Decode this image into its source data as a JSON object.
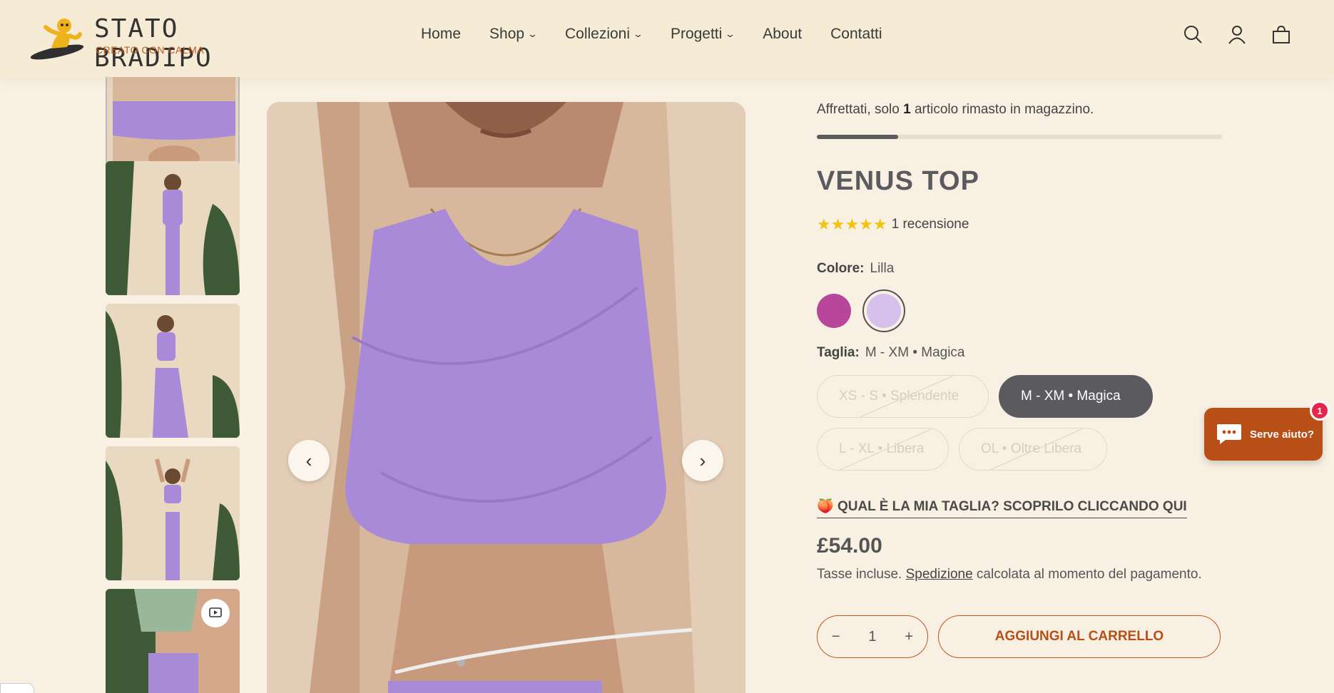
{
  "brand": {
    "name": "STATO BRADIPO",
    "tagline": "CREATO CON CALMA"
  },
  "nav": [
    {
      "label": "Home",
      "dropdown": false
    },
    {
      "label": "Shop",
      "dropdown": true
    },
    {
      "label": "Collezioni",
      "dropdown": true
    },
    {
      "label": "Progetti",
      "dropdown": true
    },
    {
      "label": "About",
      "dropdown": false
    },
    {
      "label": "Contatti",
      "dropdown": false
    }
  ],
  "header_icons": [
    "search-icon",
    "account-icon",
    "cart-bag-icon"
  ],
  "gallery": {
    "thumbnails": [
      "thumb-front-crop",
      "thumb-back-full",
      "thumb-back-side",
      "thumb-front-arms-up",
      "thumb-video"
    ],
    "video_icon": "play-video-icon",
    "prev_icon": "chevron-left-icon",
    "next_icon": "chevron-right-icon"
  },
  "product": {
    "stock_prefix": "Affrettati, solo ",
    "stock_count": "1",
    "stock_suffix": " articolo rimasto in magazzino.",
    "stock_level": 0.2,
    "title": "VENUS TOP",
    "stars": "★★★★★",
    "rating_value": 5,
    "reviews": "1 recensione",
    "color_label": "Colore:",
    "color_value": "Lilla",
    "colors": [
      {
        "name": "Magenta",
        "hex": "#b8469b",
        "selected": false
      },
      {
        "name": "Lilla",
        "hex": "#d6c0ec",
        "selected": true
      }
    ],
    "size_label": "Taglia:",
    "size_value": "M - XM • Magica",
    "sizes": [
      {
        "label": "XS - S • Splendente",
        "available": false,
        "selected": false
      },
      {
        "label": "M - XM • Magica",
        "available": true,
        "selected": true
      },
      {
        "label": "L - XL • Libera",
        "available": false,
        "selected": false
      },
      {
        "label": "OL • Oltre Libera",
        "available": false,
        "selected": false
      }
    ],
    "size_guide_icon": "peach-emoji",
    "size_guide": "QUAL È LA MIA TAGLIA? SCOPRILO CLICCANDO QUI",
    "price": "£54.00",
    "tax_prefix": "Tasse incluse. ",
    "tax_link": "Spedizione",
    "tax_suffix": " calcolata al momento del pagamento.",
    "quantity": "1",
    "qty_minus": "−",
    "qty_plus": "+",
    "add_to_cart": "AGGIUNGI AL CARRELLO"
  },
  "chat": {
    "label": "Serve aiuto?",
    "badge": "1"
  },
  "colors": {
    "background": "#f8f1e3",
    "header": "#f6ecd6",
    "accent": "#b84f16",
    "dark": "#5b5a5e",
    "star": "#f1c40f",
    "lilac": "#a98ad9"
  }
}
